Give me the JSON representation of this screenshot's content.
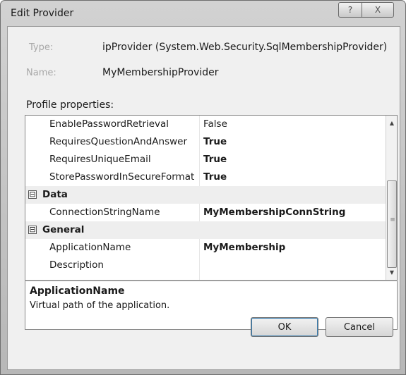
{
  "window": {
    "title": "Edit Provider",
    "help_glyph": "?",
    "close_glyph": "X"
  },
  "fields": {
    "type_label": "Type:",
    "type_value": "ipProvider (System.Web.Security.SqlMembershipProvider)",
    "name_label": "Name:",
    "name_value": "MyMembershipProvider"
  },
  "section_label": "Profile properties:",
  "grid": {
    "rows": [
      {
        "kind": "prop",
        "name": "EnablePasswordRetrieval",
        "value": "False",
        "bold": false
      },
      {
        "kind": "prop",
        "name": "RequiresQuestionAndAnswer",
        "value": "True",
        "bold": true
      },
      {
        "kind": "prop",
        "name": "RequiresUniqueEmail",
        "value": "True",
        "bold": true
      },
      {
        "kind": "prop",
        "name": "StorePasswordInSecureFormat",
        "value": "True",
        "bold": true
      },
      {
        "kind": "cat",
        "name": "Data",
        "expander": "⊟"
      },
      {
        "kind": "prop",
        "name": "ConnectionStringName",
        "value": "MyMembershipConnString",
        "bold": true
      },
      {
        "kind": "cat",
        "name": "General",
        "expander": "⊟"
      },
      {
        "kind": "prop",
        "name": "ApplicationName",
        "value": "MyMembership",
        "bold": true
      },
      {
        "kind": "prop",
        "name": "Description",
        "value": "",
        "bold": false
      }
    ]
  },
  "description": {
    "title": "ApplicationName",
    "text": "Virtual path of the application."
  },
  "buttons": {
    "ok": "OK",
    "cancel": "Cancel"
  }
}
